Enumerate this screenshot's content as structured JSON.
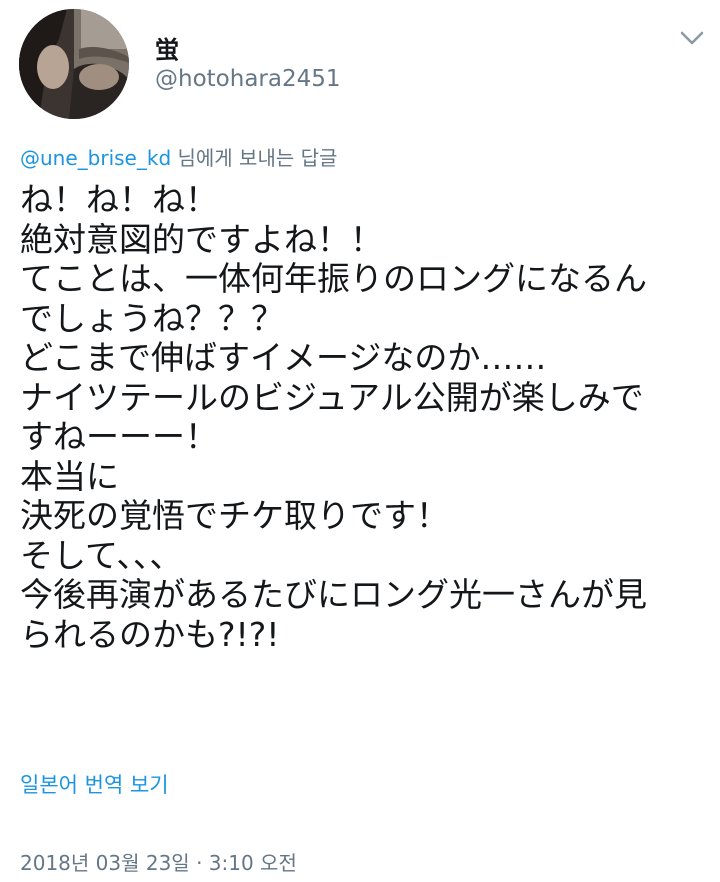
{
  "author": {
    "display_name": "蛍",
    "username": "@hotohara2451",
    "avatar_icon": "profile-photo-avatar"
  },
  "menu": {
    "icon": "chevron-down-icon"
  },
  "reply": {
    "mention": "@une_brise_kd",
    "suffix": " 님에게 보내는 답글"
  },
  "tweet": {
    "lines": [
      "ね！ね！ね！",
      "絶対意図的ですよね！！",
      "てことは、一体何年振りのロングになるん",
      "でしょうね？？？",
      "どこまで伸ばすイメージなのか……",
      "ナイツテールのビジュアル公開が楽しみで",
      "すねーーー！",
      "本当に",
      "決死の覚悟でチケ取りです！",
      "そして、、、",
      "今後再演があるたびにロング光一さんが見",
      "られるのかも?!?!"
    ]
  },
  "translate": {
    "label": "일본어 번역 보기"
  },
  "timestamp": "2018년 03월 23일 · 3:10 오전",
  "colors": {
    "link": "#1b95e0",
    "secondary_text": "#657786",
    "primary_text": "#14171a"
  }
}
